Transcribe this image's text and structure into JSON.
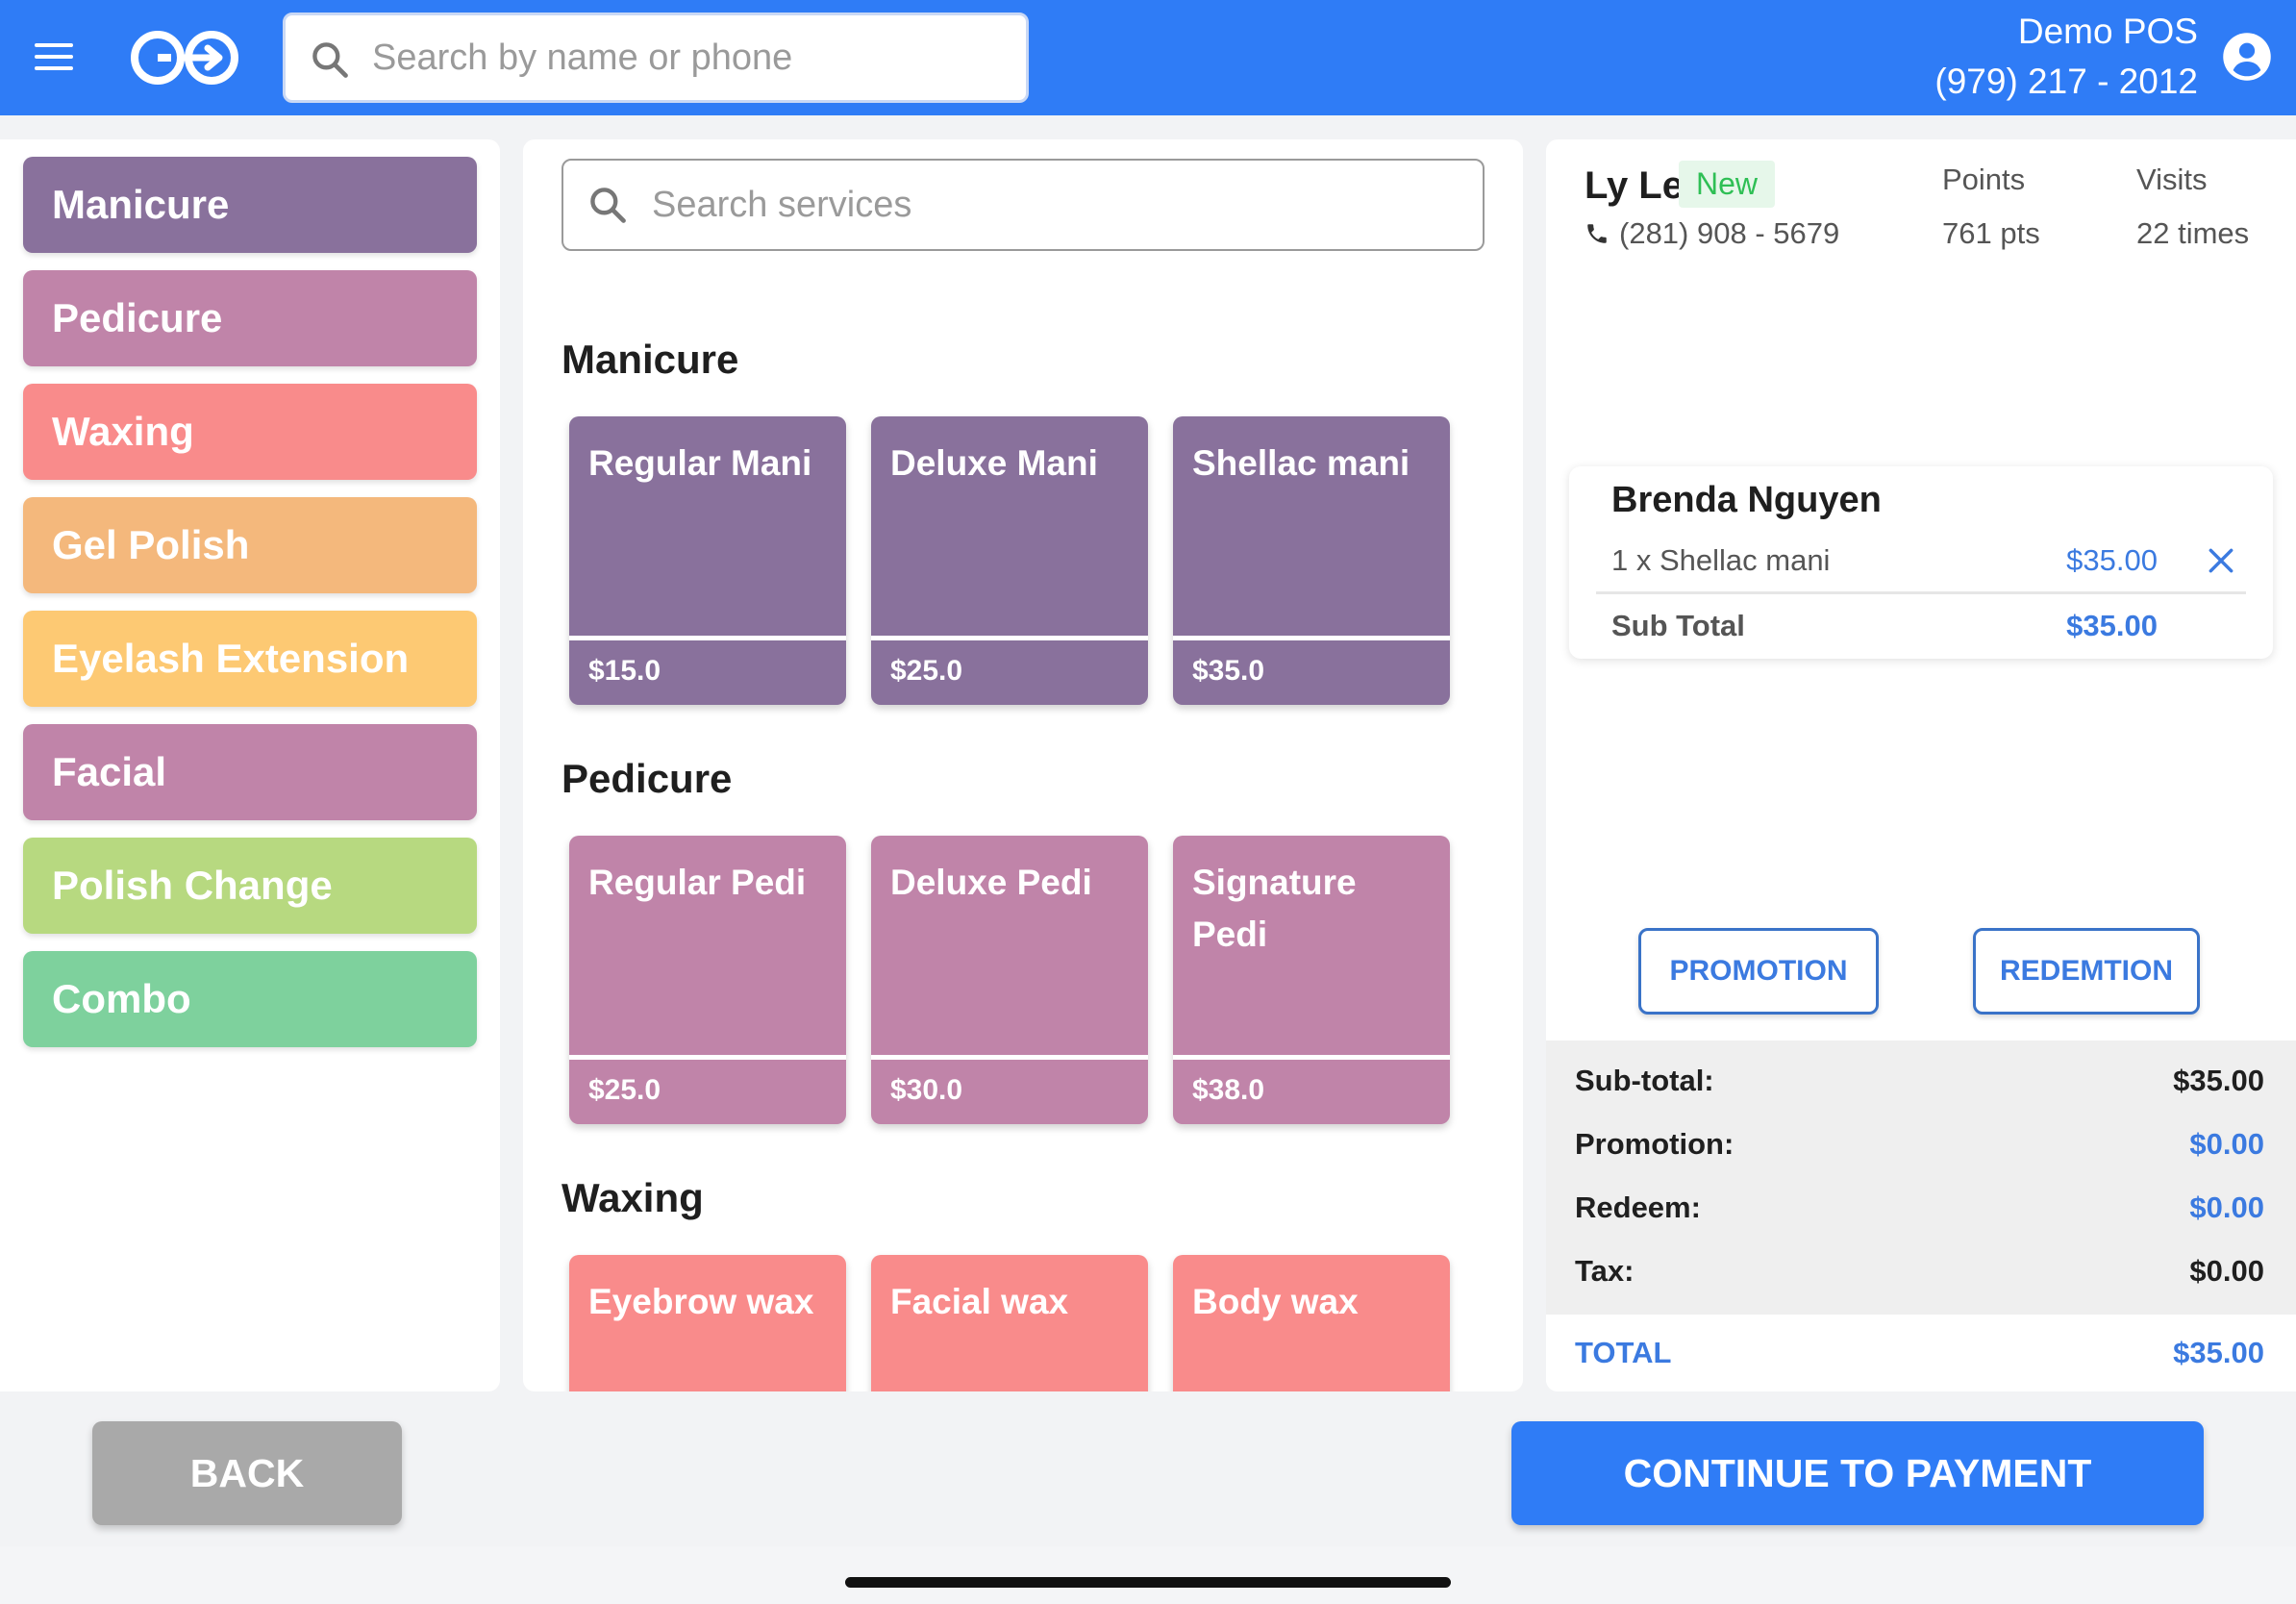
{
  "header": {
    "search_placeholder": "Search by name or phone",
    "store_name": "Demo POS",
    "store_phone": "(979) 217 - 2012",
    "colors": {
      "bar": "#2f7cf6"
    }
  },
  "categories": [
    {
      "label": "Manicure",
      "color": "#89719c"
    },
    {
      "label": "Pedicure",
      "color": "#c084a9"
    },
    {
      "label": "Waxing",
      "color": "#f98b8b"
    },
    {
      "label": "Gel Polish",
      "color": "#f4b87c"
    },
    {
      "label": "Eyelash Extension",
      "color": "#fdc973"
    },
    {
      "label": "Facial",
      "color": "#c084a9"
    },
    {
      "label": "Polish Change",
      "color": "#b7d980"
    },
    {
      "label": "Combo",
      "color": "#7ed19d"
    }
  ],
  "services": {
    "search_placeholder": "Search services",
    "sections": [
      {
        "title": "Manicure",
        "color": "#89719c",
        "items": [
          {
            "name": "Regular Mani",
            "price": "$15.0"
          },
          {
            "name": "Deluxe Mani",
            "price": "$25.0"
          },
          {
            "name": "Shellac mani",
            "price": "$35.0"
          }
        ]
      },
      {
        "title": "Pedicure",
        "color": "#c084a9",
        "items": [
          {
            "name": "Regular Pedi",
            "price": "$25.0"
          },
          {
            "name": "Deluxe Pedi",
            "price": "$30.0"
          },
          {
            "name": "Signature Pedi",
            "price": "$38.0"
          }
        ]
      },
      {
        "title": "Waxing",
        "color": "#f98b8b",
        "items": [
          {
            "name": "Eyebrow wax",
            "price": ""
          },
          {
            "name": "Facial wax",
            "price": ""
          },
          {
            "name": "Body wax",
            "price": ""
          }
        ]
      }
    ]
  },
  "customer": {
    "name": "Ly Le",
    "badge": "New",
    "phone": "(281) 908 - 5679",
    "points_label": "Points",
    "points_value": "761 pts",
    "visits_label": "Visits",
    "visits_value": "22 times"
  },
  "ticket": {
    "technician": "Brenda Nguyen",
    "line_item": "1 x Shellac mani",
    "line_price": "$35.00",
    "subtotal_label": "Sub Total",
    "subtotal_value": "$35.00"
  },
  "actions": {
    "promotion_label": "PROMOTION",
    "redemption_label": "REDEMTION"
  },
  "summary": {
    "subtotal_label": "Sub-total:",
    "subtotal_value": "$35.00",
    "promotion_label": "Promotion:",
    "promotion_value": "$0.00",
    "redeem_label": "Redeem:",
    "redeem_value": "$0.00",
    "tax_label": "Tax:",
    "tax_value": "$0.00",
    "total_label": "TOTAL",
    "total_value": "$35.00",
    "accent_color": "#3b7ae0"
  },
  "footer": {
    "back_label": "BACK",
    "continue_label": "CONTINUE TO PAYMENT"
  }
}
